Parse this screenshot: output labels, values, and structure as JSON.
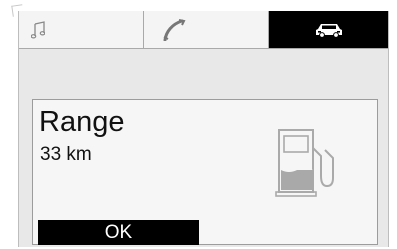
{
  "tabs": [
    {
      "icon": "music-note-icon",
      "selected": false
    },
    {
      "icon": "phone-icon",
      "selected": false
    },
    {
      "icon": "car-icon",
      "selected": true
    }
  ],
  "info": {
    "title": "Range",
    "value": "33 km",
    "icon": "fuel-pump-icon"
  },
  "actions": {
    "ok_label": "OK"
  },
  "colors": {
    "selected_tab": "#000000",
    "screen_bg": "#e8e8e8",
    "button_bg": "#000000"
  }
}
